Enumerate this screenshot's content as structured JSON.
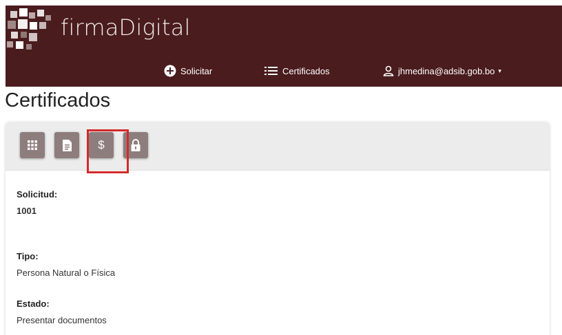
{
  "brand": {
    "name": "firmaDigital"
  },
  "nav": {
    "solicitar": "Solicitar",
    "certificados": "Certificados",
    "user": "jhmedina@adsib.gob.bo",
    "caret": "▾"
  },
  "page": {
    "title": "Certificados"
  },
  "toolbar": {
    "buttons": [
      {
        "icon": "grid-icon"
      },
      {
        "icon": "document-icon"
      },
      {
        "icon": "dollar-icon",
        "glyph": "$",
        "highlighted": true
      },
      {
        "icon": "lock-icon"
      }
    ]
  },
  "details": {
    "solicitud_label": "Solicitud:",
    "solicitud_value": "1001",
    "tipo_label": "Tipo:",
    "tipo_value": "Persona Natural o Física",
    "estado_label": "Estado:",
    "estado_value": "Presentar documentos"
  },
  "colors": {
    "navbar": "#4a1c1e",
    "button": "#8e7d7d",
    "highlight": "#d42a2a"
  }
}
